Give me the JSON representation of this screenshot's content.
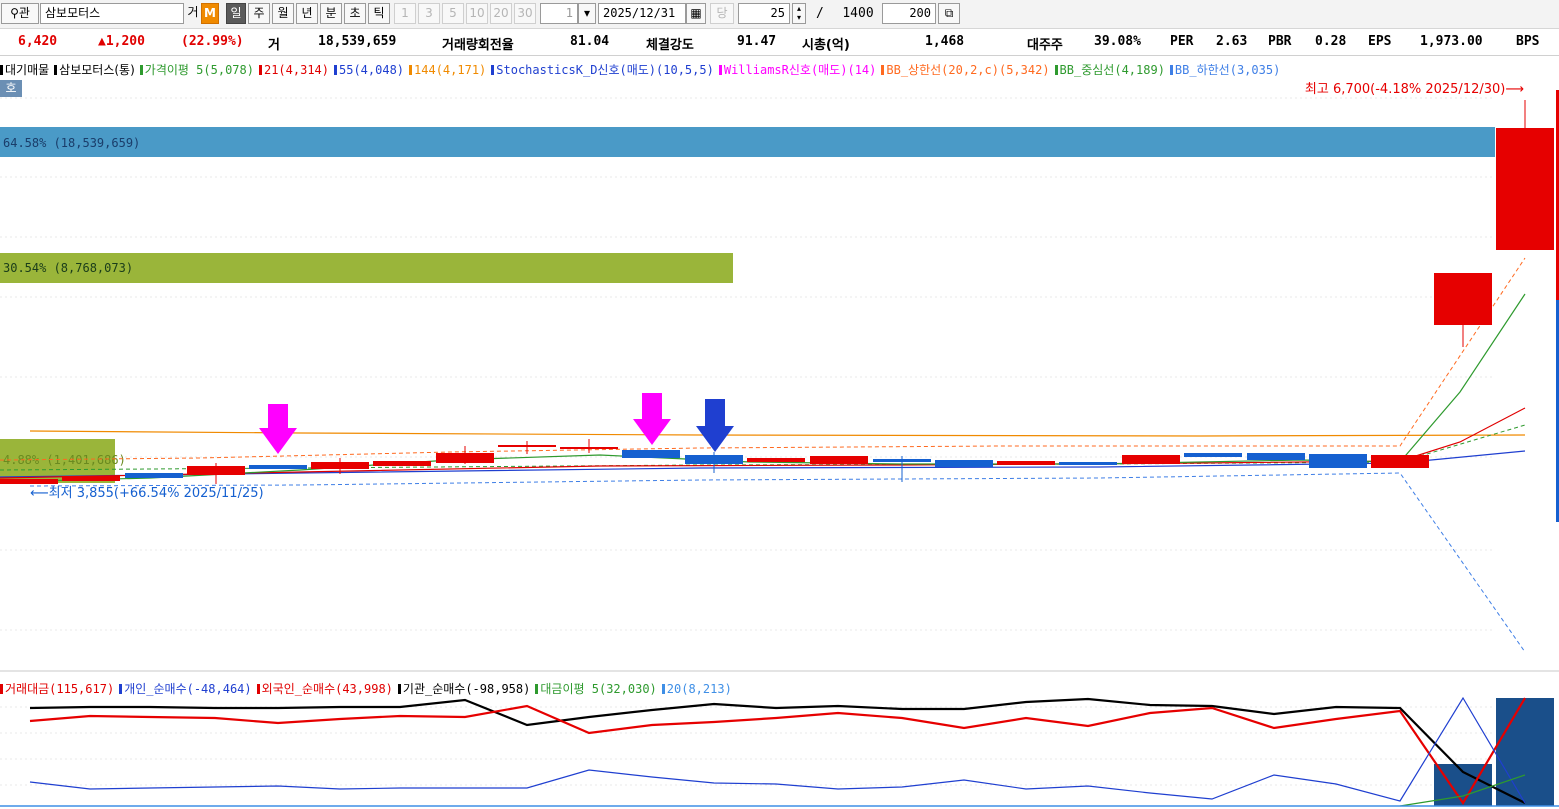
{
  "toolbar": {
    "search_icon": "search-icon",
    "gwan_label": "관",
    "stock_name": "삼보모터스",
    "ge_label": "거",
    "m_label": "M",
    "period_buttons": [
      "일",
      "주",
      "월",
      "년",
      "분",
      "초",
      "틱"
    ],
    "interval_buttons": [
      "1",
      "3",
      "5",
      "10",
      "20",
      "30"
    ],
    "count_value": "1",
    "date_value": "2025/12/31",
    "dang_label": "당",
    "view_count": "25",
    "slash": "/",
    "total_count": "1400",
    "display_count": "200"
  },
  "quote": {
    "price": "6,420",
    "change": "▲1,200",
    "change_pct": "(22.99%)",
    "volume_label": "거",
    "volume": "18,539,659",
    "turnover_label": "거래량회전율",
    "turnover": "81.04",
    "strength_label": "체결강도",
    "strength": "91.47",
    "mcap_label": "시총(억)",
    "mcap": "1,468",
    "major_label": "대주주",
    "major": "39.08%",
    "per_label": "PER",
    "per": "2.63",
    "pbr_label": "PBR",
    "pbr": "0.28",
    "eps_label": "EPS",
    "eps": "1,973.00",
    "bps_label": "BPS"
  },
  "main_legend": [
    {
      "text": "대기매물",
      "color": "#000000"
    },
    {
      "text": "삼보모터스(통)",
      "color": "#000000"
    },
    {
      "text": "가격이평 5(5,078)",
      "color": "#2e9a2e"
    },
    {
      "text": "21(4,314)",
      "color": "#e00000"
    },
    {
      "text": "55(4,048)",
      "color": "#1f3fd0"
    },
    {
      "text": "144(4,171)",
      "color": "#f08a00"
    },
    {
      "text": "StochasticsK_D신호(매도)(10,5,5)",
      "color": "#1f3fd0"
    },
    {
      "text": "WilliamsR신호(매도)(14)",
      "color": "#ff00ff"
    },
    {
      "text": "BB_상한선(20,2,c)(5,342)",
      "color": "#ff6a20"
    },
    {
      "text": "BB_중심선(4,189)",
      "color": "#2e9a2e"
    },
    {
      "text": "BB_하한선(3,035)",
      "color": "#3f7fe6"
    }
  ],
  "ho_label": "호",
  "high_label": "최고 6,700(-4.18% 2025/12/30)⟶",
  "low_label": "⟵최저 3,855(+66.54% 2025/11/25)",
  "volume_profile": [
    {
      "pct": 64.58,
      "label": "64.58% (18,539,659)",
      "color": "#4a9ac7"
    },
    {
      "pct": 30.54,
      "label": "30.54% (8,768,073)",
      "color": "#9ab53a"
    },
    {
      "pct": 4.88,
      "label": "4.88% (1,401,686)",
      "color": "#9ab53a"
    }
  ],
  "sub_legend": [
    {
      "text": "거래대금(115,617)",
      "color": "#e00000"
    },
    {
      "text": "개인_순매수(-48,464)",
      "color": "#1f3fd0"
    },
    {
      "text": "외국인_순매수(43,998)",
      "color": "#e00000"
    },
    {
      "text": "기관_순매수(-98,958)",
      "color": "#000000"
    },
    {
      "text": "대금이평 5(32,030)",
      "color": "#2e9a2e"
    },
    {
      "text": "20(8,213)",
      "color": "#3f8fe6"
    }
  ],
  "colors": {
    "up": "#e60000",
    "down": "#1560d0",
    "ma144": "#f08a00",
    "bb_mid": "#2e9a2e"
  }
}
